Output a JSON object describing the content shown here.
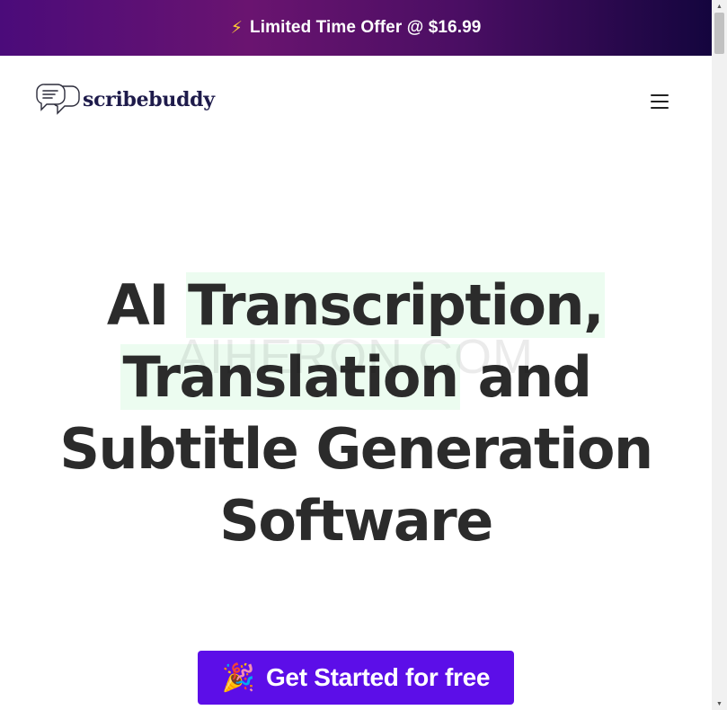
{
  "promo": {
    "icon": "lightning-bolt-icon",
    "text": "Limited Time Offer @ $16.99"
  },
  "header": {
    "logo_icon": "chat-bubbles-icon",
    "logo_text": "scribebuddy",
    "menu_icon": "hamburger-menu-icon"
  },
  "hero": {
    "title_part1": "AI ",
    "title_highlight1": "Transcription,",
    "title_highlight2": "Translation",
    "title_part2": " and Subtitle Generation Software",
    "watermark": "AIHERON.COM"
  },
  "cta": {
    "icon": "party-popper-icon",
    "label": "Get Started for free"
  },
  "colors": {
    "promo_gradient_start": "#4b0b7a",
    "promo_gradient_end": "#14053e",
    "cta_background": "#5c0ee8",
    "highlight_background": "#ecfcf0",
    "title_text": "#2b2b2b",
    "logo_text": "#1e1b4b"
  }
}
